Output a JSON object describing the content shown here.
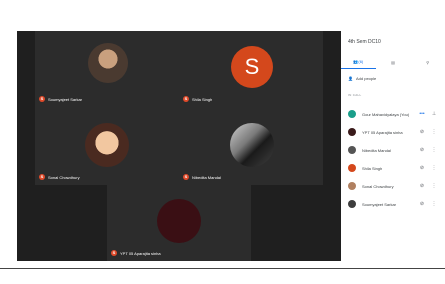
{
  "panel": {
    "title": "4th Sem DC10",
    "tabs": [
      {
        "label": "(6)",
        "icon": "people-icon"
      },
      {
        "label": "",
        "icon": "chat-icon"
      },
      {
        "label": "",
        "icon": "activities-icon"
      }
    ],
    "add_people": "Add people",
    "section_label": "IN CALL",
    "participants": [
      {
        "name": "Gour Mahavidyalaya (You)",
        "avatar_color": "#1a9e8a",
        "status": "•••"
      },
      {
        "name": "YPT 05 Aparajita sinha",
        "avatar_color": "#3a1a1a",
        "status": "muted"
      },
      {
        "name": "Nibedita Mandal",
        "avatar_color": "#555555",
        "status": "muted"
      },
      {
        "name": "Shila Singh",
        "avatar_color": "#d4481c",
        "status": "muted"
      },
      {
        "name": "Sonal Chowdhury",
        "avatar_color": "#b08060",
        "status": "muted"
      },
      {
        "name": "Soumyajeet Sarkar",
        "avatar_color": "#3d3d3d",
        "status": "muted"
      }
    ]
  },
  "tiles": [
    {
      "name": "Soumyajeet Sarkar"
    },
    {
      "name": "Shila Singh",
      "letter": "S"
    },
    {
      "name": "Sonal Chowdhury"
    },
    {
      "name": "Nibedita Mandal"
    },
    {
      "name": "YPT 05 Aparajita sinha"
    }
  ],
  "colors": {
    "accent": "#1a73e8",
    "tile_bg": "#2c2c2c",
    "grid_bg": "#1f1f1f"
  }
}
